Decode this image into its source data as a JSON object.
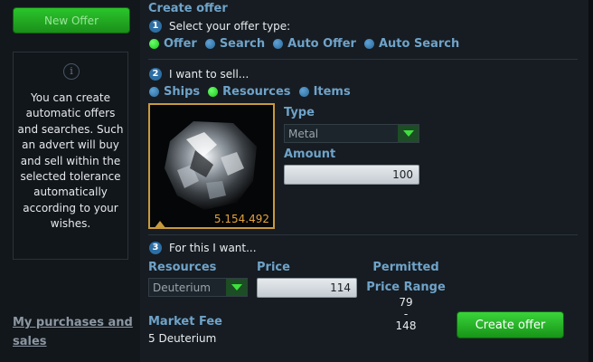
{
  "sidebar": {
    "new_offer_label": "New Offer",
    "info_icon_glyph": "i",
    "info_text": "You can create automatic offers and searches. Such an advert will buy and sell within the selected tolerance automatically according to your wishes.",
    "purchases_link": "My purchases and sales"
  },
  "main": {
    "title": "Create offer",
    "step1": {
      "num": "1",
      "label": "Select your offer type:",
      "options": [
        {
          "label": "Offer",
          "selected": true
        },
        {
          "label": "Search",
          "selected": false
        },
        {
          "label": "Auto Offer",
          "selected": false
        },
        {
          "label": "Auto Search",
          "selected": false
        }
      ]
    },
    "step2": {
      "num": "2",
      "label": "I want to sell...",
      "options": [
        {
          "label": "Ships",
          "selected": false
        },
        {
          "label": "Resources",
          "selected": true
        },
        {
          "label": "Items",
          "selected": false
        }
      ],
      "resource_amount": "5.154.492",
      "type_label": "Type",
      "type_value": "Metal",
      "amount_label": "Amount",
      "amount_value": "100"
    },
    "step3": {
      "num": "3",
      "label": "For this I want...",
      "resources_label": "Resources",
      "resources_value": "Deuterium",
      "price_label": "Price",
      "price_value": "114",
      "permitted_label": "Permitted",
      "price_range_label": "Price Range",
      "range_min": "79",
      "range_sep": "-",
      "range_max": "148",
      "market_fee_label": "Market Fee",
      "market_fee_value": "5 Deuterium",
      "create_button": "Create offer"
    }
  },
  "colors": {
    "accent": "#6fa3c9",
    "green": "#1fb81f",
    "gold": "#c89a3c"
  }
}
